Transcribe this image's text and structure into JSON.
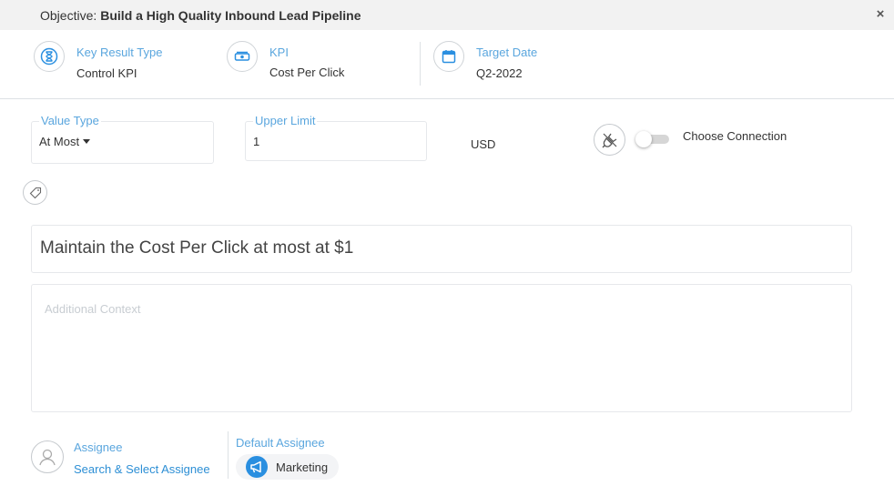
{
  "header": {
    "objective_label": "Objective:",
    "objective_title": "Build a High Quality Inbound Lead Pipeline",
    "close_glyph": "×"
  },
  "info": {
    "key_result_type": {
      "label": "Key Result Type",
      "value": "Control KPI",
      "icon": "hourglass-icon"
    },
    "kpi": {
      "label": "KPI",
      "value": "Cost Per Click",
      "icon": "money-icon"
    },
    "target_date": {
      "label": "Target Date",
      "value": "Q2-2022",
      "icon": "calendar-icon"
    }
  },
  "fields": {
    "value_type": {
      "label": "Value Type",
      "value": "At Most"
    },
    "upper_limit": {
      "label": "Upper Limit",
      "value": "1"
    },
    "unit": "USD",
    "connection": {
      "label": "Choose Connection",
      "enabled": false
    }
  },
  "statement": "Maintain the Cost Per Click at most at $1",
  "context": {
    "placeholder": "Additional Context",
    "value": ""
  },
  "assignee": {
    "label": "Assignee",
    "link_text": "Search & Select Assignee",
    "default_label": "Default Assignee",
    "default_value": "Marketing"
  },
  "colors": {
    "accent": "#5aa6de",
    "link": "#2d8fd5",
    "chip_icon": "#2a8fe0",
    "header_bg": "#f2f2f2"
  }
}
